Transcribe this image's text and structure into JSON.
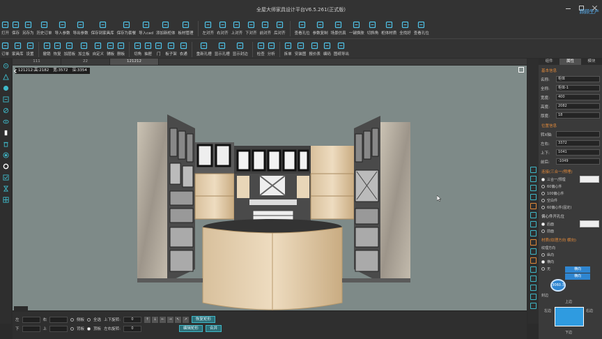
{
  "app": {
    "title": "全屋大师家具设计平台V6.5.261(正式版)",
    "account_label": "顾顾生产"
  },
  "toolbar1": [
    {
      "label": "打开",
      "icon": "folder-open-icon"
    },
    {
      "label": "保存",
      "icon": "save-icon"
    },
    {
      "label": "另存为",
      "icon": "save-as-icon"
    },
    {
      "label": "历史订单",
      "icon": "history-icon"
    },
    {
      "label": "导入参数",
      "icon": "import-params-icon"
    },
    {
      "label": "导出参数",
      "icon": "export-params-icon"
    },
    {
      "label": "保存到家具库",
      "icon": "save-library-icon"
    },
    {
      "label": "保存为套餐",
      "icon": "save-package-icon"
    },
    {
      "label": "导入cad",
      "icon": "import-cad-icon"
    },
    {
      "label": "添加新柜体",
      "icon": "add-cabinet-icon"
    },
    {
      "label": "板材管理",
      "icon": "board-manage-icon"
    },
    {
      "label": "左对齐",
      "icon": "align-left-icon"
    },
    {
      "label": "右对齐",
      "icon": "align-right-icon"
    },
    {
      "label": "上对齐",
      "icon": "align-top-icon"
    },
    {
      "label": "下对齐",
      "icon": "align-bottom-icon"
    },
    {
      "label": "前对齐",
      "icon": "align-front-icon"
    },
    {
      "label": "后对齐",
      "icon": "align-back-icon"
    },
    {
      "label": "查看孔位",
      "icon": "view-holes-icon"
    },
    {
      "label": "参数复制",
      "icon": "copy-params-icon"
    },
    {
      "label": "场景仿真",
      "icon": "scene-sim-icon"
    },
    {
      "label": "一键换肤",
      "icon": "reskin-icon"
    },
    {
      "label": "切斜角",
      "icon": "bevel-icon"
    },
    {
      "label": "柜体材质",
      "icon": "material-icon"
    },
    {
      "label": "全找好",
      "icon": "find-all-icon"
    },
    {
      "label": "查看孔位",
      "icon": "view-holes-icon-2"
    }
  ],
  "toolbar2": [
    {
      "label": "订单",
      "icon": "order-icon"
    },
    {
      "label": "家具库",
      "icon": "furniture-lib-icon"
    },
    {
      "label": "设置",
      "icon": "settings-icon"
    },
    {
      "label": "撤销",
      "icon": "undo-icon"
    },
    {
      "label": "恢复",
      "icon": "redo-icon"
    },
    {
      "label": "加层板",
      "icon": "add-shelf-icon"
    },
    {
      "label": "加立板",
      "icon": "add-upright-icon"
    },
    {
      "label": "自定义",
      "icon": "custom-icon"
    },
    {
      "label": "辅板",
      "icon": "aux-board-icon"
    },
    {
      "label": "删板",
      "icon": "delete-board-icon"
    },
    {
      "label": "切角",
      "icon": "cut-corner-icon"
    },
    {
      "label": "抽屉",
      "icon": "drawer-icon"
    },
    {
      "label": "门",
      "icon": "door-icon"
    },
    {
      "label": "板子架",
      "icon": "board-rack-icon"
    },
    {
      "label": "衣通",
      "icon": "rail-icon"
    },
    {
      "label": "重新孔槽",
      "icon": "regen-holes-icon"
    },
    {
      "label": "显示孔槽",
      "icon": "show-holes-icon"
    },
    {
      "label": "显示封边",
      "icon": "show-edge-icon"
    },
    {
      "label": "检查",
      "icon": "check-icon"
    },
    {
      "label": "分析",
      "icon": "analyze-icon"
    },
    {
      "label": "拆单",
      "icon": "split-order-icon"
    },
    {
      "label": "安装图",
      "icon": "install-diagram-icon"
    },
    {
      "label": "报价表",
      "icon": "quote-icon"
    },
    {
      "label": "编码",
      "icon": "code-icon"
    },
    {
      "label": "图纸导出",
      "icon": "export-drawing-icon"
    }
  ],
  "tabs": [
    "111",
    "22",
    "121212"
  ],
  "active_tab": 2,
  "viewport": {
    "dims": {
      "h": "121212:高:2182",
      "w": "宽:3572",
      "d": "深:3354"
    }
  },
  "panel": {
    "tabs": [
      "组件",
      "属性",
      "模块"
    ],
    "active_tab": 1,
    "section_basic": "基本信息",
    "fields_basic": [
      {
        "label": "名称:",
        "value": "柜体"
      },
      {
        "label": "全称:",
        "value": "柜体-1"
      },
      {
        "label": "宽度:",
        "value": "400"
      },
      {
        "label": "高度:",
        "value": "2082"
      },
      {
        "label": "厚度:",
        "value": "18"
      }
    ],
    "section_pos": "位置信息",
    "fields_pos": [
      {
        "label": "转X轴:",
        "value": ""
      },
      {
        "label": "左右:",
        "value": "3372"
      },
      {
        "label": "上下:",
        "value": "1041"
      },
      {
        "label": "前后:",
        "value": "-1049"
      }
    ],
    "section_conn": "连接(三合一/预埋)",
    "conn_options": [
      "三合一/预埋",
      "60偏心件",
      "100偏心件",
      "空白件",
      "60偏心件(固定)"
    ],
    "conn_selected": 0,
    "section_hole": "偏心件开孔位",
    "hole_options": [
      "后面",
      "前面"
    ],
    "hole_selected": 0,
    "section_tex": "材质(纹理方向 横向)",
    "tex_label": "纹理方向",
    "tex_options": [
      "纵向",
      "横向",
      "无"
    ],
    "tex_selected": 1,
    "tex_btn_1": "横向",
    "tex_btn_2": "横向",
    "badge": "3060.3",
    "seal_label": "封边",
    "seal_top": "上边",
    "seal_left": "左边",
    "seal_right": "右边",
    "seal_bottom": "下边"
  },
  "bottom": {
    "row1": {
      "left": "左",
      "right": "右",
      "opt1": "侧板",
      "opt2": "全选",
      "updown_rotate": "上下旋转:",
      "updown_val": "0",
      "btn": "恢复矩形"
    },
    "row2": {
      "down": "下",
      "up": "上",
      "opt1": "背板",
      "opt2": "顶板",
      "lr_rotate": "左右旋转:",
      "lr_val": "0",
      "btn1": "编辑矩形",
      "btn2": "合并"
    }
  },
  "colors": {
    "accent": "#3fb8c8",
    "blue": "#2f86d1",
    "section": "#e0893a",
    "viewport_bg": "#7e8a88"
  }
}
